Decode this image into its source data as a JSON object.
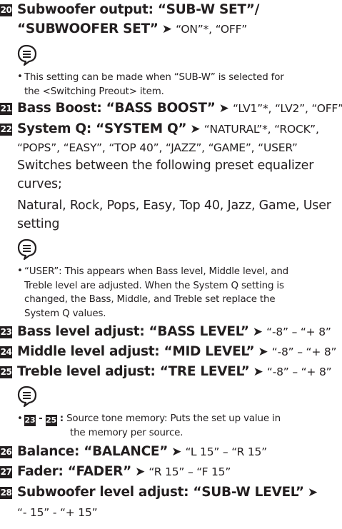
{
  "items": {
    "i20": {
      "num": "20",
      "line1": "Subwoofer output: “SUB-W SET”/",
      "line2": "“SUBWOOFER SET”",
      "arrow": "➤",
      "values": "“ON”*, “OFF”"
    },
    "note20": {
      "bullet": "•",
      "line1": "This setting can be made when “SUB-W” is selected for",
      "line2": "the <Switching Preout> item."
    },
    "i21": {
      "num": "21",
      "label": "Bass Boost: “BASS BOOST”",
      "arrow": "➤",
      "values": "“LV1”*, “LV2”, “OFF”"
    },
    "i22": {
      "num": "22",
      "label": "System Q: “SYSTEM Q”",
      "arrow": "➤",
      "values": "“NATURAL”*, “ROCK”,",
      "values2": "“POPS”, “EASY”, “TOP 40”, “JAZZ”, “GAME”, “USER”",
      "desc1": "Switches between the following preset equalizer",
      "desc2": "curves;",
      "list1": "Natural, Rock, Pops, Easy, Top 40, Jazz, Game, User",
      "list2": "setting"
    },
    "note22": {
      "bullet": "•",
      "line1": "“USER”: This appears when Bass level, Middle level, and",
      "line2": "Treble level are adjusted. When the System Q setting is",
      "line3": "changed, the Bass, Middle, and Treble set replace the",
      "line4": "System Q values."
    },
    "i23": {
      "num": "23",
      "label": "Bass level adjust: “BASS LEVEL”",
      "arrow": "➤",
      "values": "“-8” – “+ 8”"
    },
    "i24": {
      "num": "24",
      "label": "Middle level adjust: “MID LEVEL”",
      "arrow": "➤",
      "values": "“-8” – “+ 8”"
    },
    "i25": {
      "num": "25",
      "label": "Treble level adjust: “TRE LEVEL”",
      "arrow": "➤",
      "values": "“-8” – “+ 8”"
    },
    "note25": {
      "bullet": "•",
      "from": "23",
      "dash": "-",
      "to": "25",
      "colon": ":",
      "line1": "Source tone memory: Puts the set up value in",
      "line2": "the memory per source."
    },
    "i26": {
      "num": "26",
      "label": "Balance: “BALANCE”",
      "arrow": "➤",
      "values": "“L 15” – “R 15”"
    },
    "i27": {
      "num": "27",
      "label": "Fader: “FADER”",
      "arrow": "➤",
      "values": "“R 15” – “F 15”"
    },
    "i28": {
      "num": "28",
      "label": "Subwoofer level adjust: “SUB-W LEVEL”",
      "arrow": "➤",
      "values": "“- 15” - “+ 15”"
    }
  },
  "icons": {
    "note": "note-icon"
  }
}
